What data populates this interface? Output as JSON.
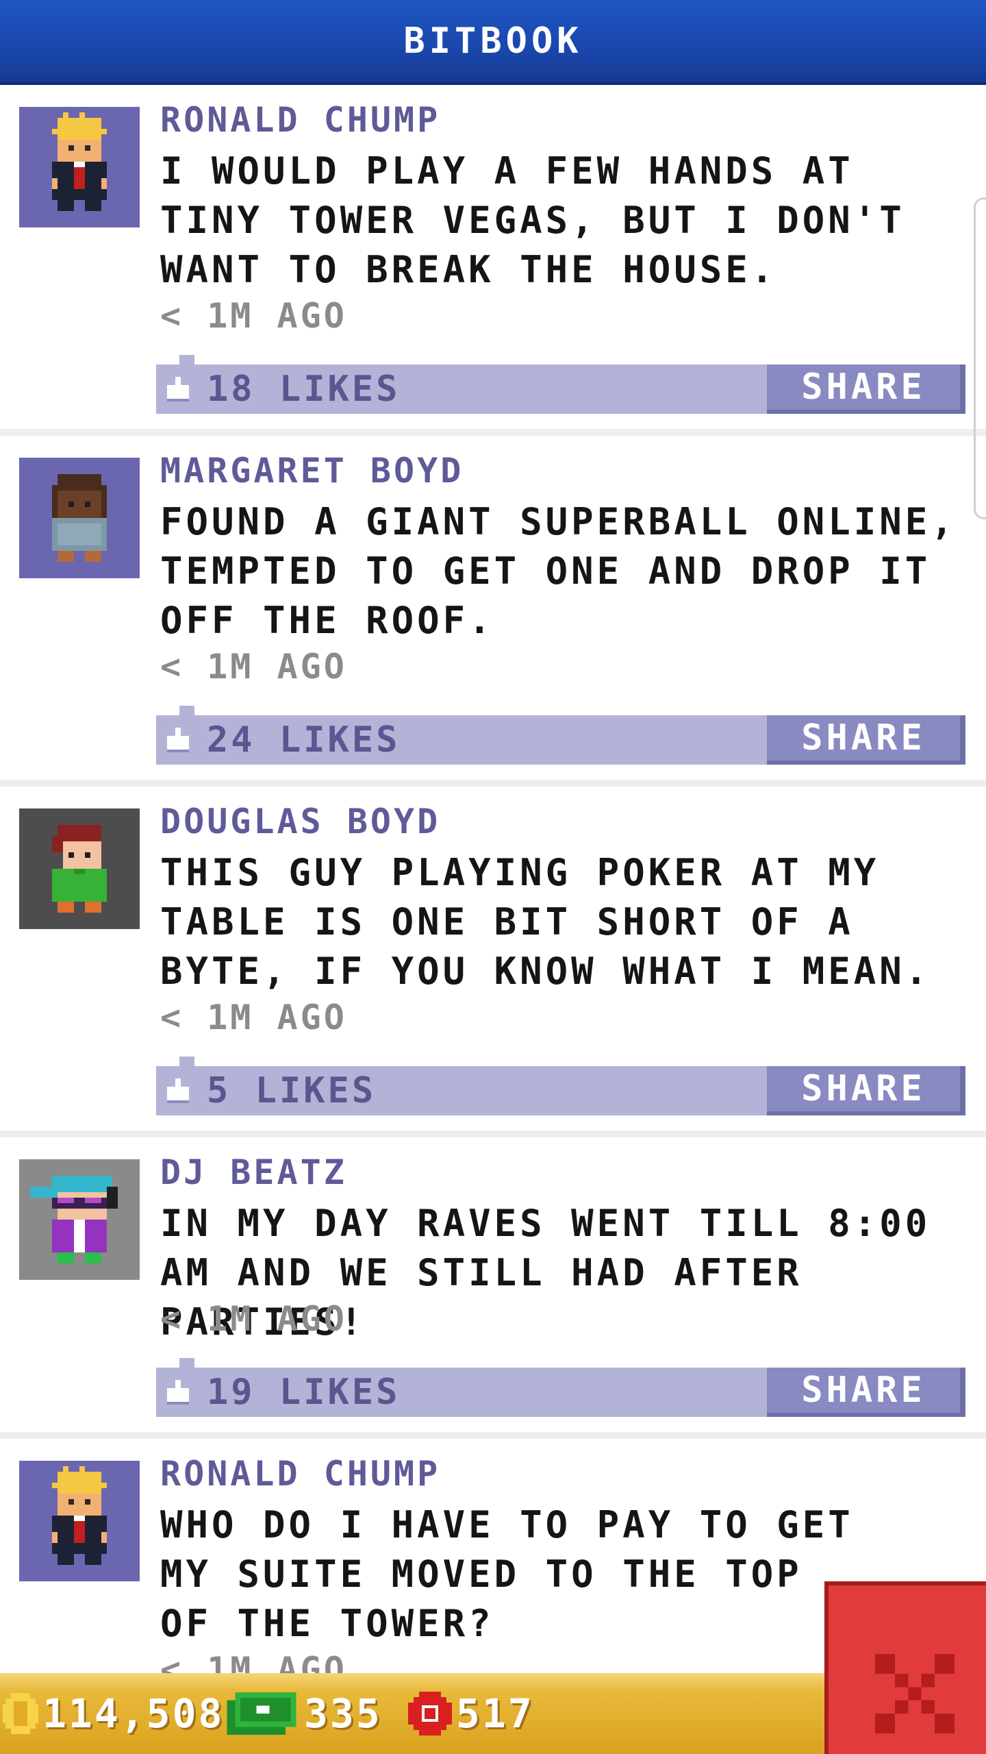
{
  "header": {
    "title": "BITBOOK"
  },
  "posts": [
    {
      "author": "RONALD CHUMP",
      "message": "I WOULD PLAY A FEW HANDS AT TINY TOWER VEGAS, BUT I DON'T WANT TO BREAK THE HOUSE.",
      "time": "< 1M AGO",
      "likes": "18 LIKES",
      "share": "SHARE",
      "avatar_icon": "blonde-suit-bitizen-avatar-icon"
    },
    {
      "author": "MARGARET BOYD",
      "message": "FOUND A GIANT SUPERBALL ONLINE, TEMPTED TO GET ONE AND DROP IT OFF THE ROOF.",
      "time": "< 1M AGO",
      "likes": "24 LIKES",
      "share": "SHARE",
      "avatar_icon": "brown-hair-bitizen-avatar-icon"
    },
    {
      "author": "DOUGLAS BOYD",
      "message": "THIS GUY PLAYING POKER AT MY TABLE IS ONE BIT SHORT OF A BYTE, IF YOU KNOW WHAT I MEAN.",
      "time": "< 1M AGO",
      "likes": "5 LIKES",
      "share": "SHARE",
      "avatar_icon": "red-hair-green-shirt-bitizen-avatar-icon"
    },
    {
      "author": "DJ BEATZ",
      "message": "IN MY DAY RAVES WENT TILL 8:00 AM AND WE STILL HAD AFTER PARTIES!",
      "time": "< 1M AGO",
      "likes": "19 LIKES",
      "share": "SHARE",
      "avatar_icon": "dj-headphones-bitizen-avatar-icon"
    },
    {
      "author": "RONALD CHUMP",
      "message": "WHO DO I HAVE TO PAY TO GET MY SUITE MOVED TO THE TOP OF THE TOWER?",
      "time": "< 1M AGO",
      "avatar_icon": "blonde-suit-bitizen-avatar-icon"
    }
  ],
  "footer": {
    "coins": "114,508",
    "bux": "335",
    "tokens": "517"
  },
  "colors": {
    "header_blue": "#1a47ad",
    "author_purple": "#5f5a98",
    "like_bar": "#b3b3d8",
    "share_button": "#8a8ac2",
    "footer_gold": "#e0ad2b",
    "close_red": "#e23b3b"
  }
}
